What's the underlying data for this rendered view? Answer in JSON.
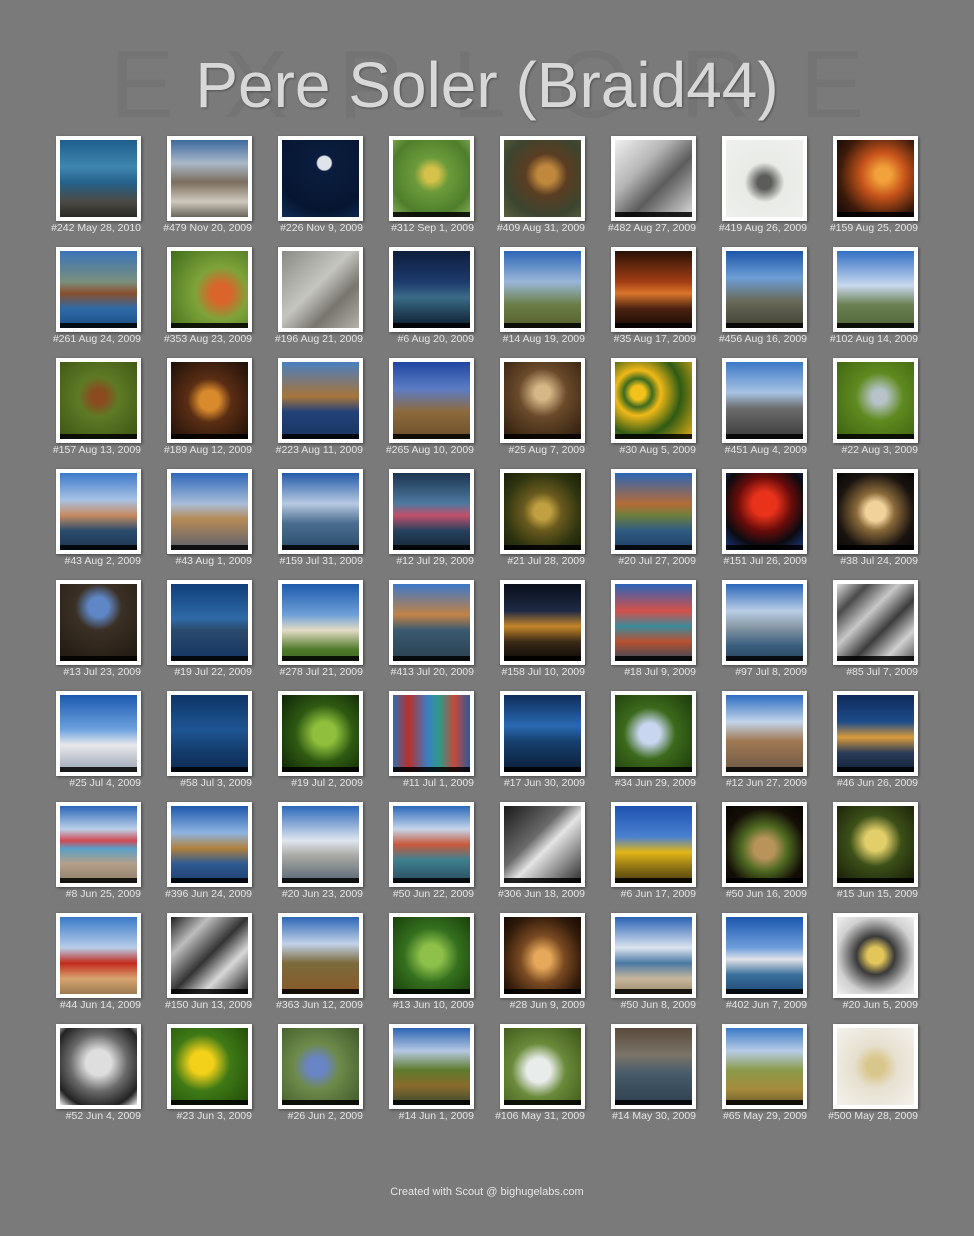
{
  "header": {
    "title": "Pere Soler (Braid44)",
    "watermark": [
      "E",
      "X",
      "P",
      "L",
      "O",
      "R",
      "E"
    ]
  },
  "footer": {
    "text": "Created with Scout @ bighugelabs.com"
  },
  "photos": [
    {
      "caption": "#242 May 28, 2010",
      "bg": "linear-gradient(180deg,#1f5e8c 0%,#3f86b0 35%,#25628a 55%,#4b4a44 80%,#2a2a25 100%)",
      "stripe": false
    },
    {
      "caption": "#479 Nov 20, 2009",
      "bg": "linear-gradient(180deg,#3d6a9c 0%,#a9b8c9 30%,#7b6e5e 55%,#cfc9bd 80%,#6b665c 100%)",
      "stripe": false
    },
    {
      "caption": "#226 Nov 9, 2009",
      "bg": "radial-gradient(circle at 55% 30%,#dfe4ea 0 10%,#0b1d3e 12%,#061631 70%,#0e2d57 100%)",
      "stripe": false
    },
    {
      "caption": "#312 Sep 1, 2009",
      "bg": "radial-gradient(circle at 50% 45%,#d6c24a 0 12%,#6c9b3b 30%,#4f7e2c 70%,#8cb157 100%)",
      "stripe": true
    },
    {
      "caption": "#409 Aug 31, 2009",
      "bg": "radial-gradient(circle at 55% 45%,#c0883d 0 15%,#5a3d22 35%,#3c4530 70%,#59603e 100%)",
      "stripe": false
    },
    {
      "caption": "#482 Aug 27, 2009",
      "bg": "linear-gradient(135deg,#efefef 0%,#b5b5b5 35%,#5c5c5c 60%,#dcdcdc 100%)",
      "stripe": true
    },
    {
      "caption": "#419 Aug 26, 2009",
      "bg": "radial-gradient(circle at 50% 55%,#5c5c5c 0 12%,#e8ebe6 35%,#f0f1ef 100%)",
      "stripe": false
    },
    {
      "caption": "#159 Aug 25, 2009",
      "bg": "radial-gradient(circle at 60% 45%,#f2a23a 0 12%,#c8541b 35%,#3a1a0a 70%,#120604 100%)",
      "stripe": true
    },
    {
      "caption": "#261 Aug 24, 2009",
      "bg": "linear-gradient(180deg,#3b74b8 0%,#7a8f7d 40%,#8a4f2e 55%,#2e6aa8 75%,#1d4d80 100%)",
      "stripe": true
    },
    {
      "caption": "#353 Aug 23, 2009",
      "bg": "radial-gradient(circle at 65% 55%,#d9652a 0 15%,#7fa33a 40%,#3f6d1b 100%)",
      "stripe": true
    },
    {
      "caption": "#196 Aug 21, 2009",
      "bg": "linear-gradient(135deg,#8b8b86 0%,#c6c6c0 45%,#77756e 70%,#b3b1aa 100%)",
      "stripe": false
    },
    {
      "caption": "#6 Aug 20, 2009",
      "bg": "linear-gradient(180deg,#0e1e3c 0%,#1c3a6c 40%,#3a6b86 60%,#0b1a2c 100%)",
      "stripe": true
    },
    {
      "caption": "#14 Aug 19, 2009",
      "bg": "linear-gradient(180deg,#2d67b5 0%,#9ab6d8 40%,#6b7d45 70%,#56612f 100%)",
      "stripe": true
    },
    {
      "caption": "#35 Aug 17, 2009",
      "bg": "linear-gradient(180deg,#2a1208 0%,#a13d14 40%,#d9762a 55%,#4b2210 75%,#1a0a04 100%)",
      "stripe": true
    },
    {
      "caption": "#456 Aug 16, 2009",
      "bg": "linear-gradient(180deg,#1e56a8 0%,#6d9ed6 35%,#6a6a5a 65%,#3f3f33 100%)",
      "stripe": true
    },
    {
      "caption": "#102 Aug 14, 2009",
      "bg": "linear-gradient(180deg,#3270c4 0%,#c9d9ee 45%,#6a8052 70%,#526638 100%)",
      "stripe": true
    },
    {
      "caption": "#157 Aug 13, 2009",
      "bg": "radial-gradient(circle at 50% 45%,#8b4a1f 0 12%,#5e7a25 35%,#3c5414 100%)",
      "stripe": true
    },
    {
      "caption": "#189 Aug 12, 2009",
      "bg": "radial-gradient(circle at 50% 50%,#d98a2c 0 18%,#5b2e14 40%,#1d0f08 100%)",
      "stripe": true
    },
    {
      "caption": "#223 Aug 11, 2009",
      "bg": "linear-gradient(180deg,#4a7fc0 0%,#a7753a 45%,#22417a 65%,#1a3560 100%)",
      "stripe": true
    },
    {
      "caption": "#265 Aug 10, 2009",
      "bg": "linear-gradient(180deg,#2146a0 0%,#5c7cc4 35%,#8d6a3c 65%,#6c4f2b 100%)",
      "stripe": true
    },
    {
      "caption": "#25 Aug 7, 2009",
      "bg": "radial-gradient(circle at 50% 40%,#d6b888 0 12%,#6a4a2a 40%,#2a1a0c 100%)",
      "stripe": true
    },
    {
      "caption": "#30 Aug 5, 2009",
      "bg": "radial-gradient(circle at 30% 40%,#f2c21b 0 10%,#3c6a1e 20%,#f0b918 32%,#2f5a14 60%,#e8b014 100%)",
      "stripe": true
    },
    {
      "caption": "#451 Aug 4, 2009",
      "bg": "linear-gradient(180deg,#3c78c6 0%,#a8c3e3 40%,#6c6c6c 60%,#3b3b3b 100%)",
      "stripe": true
    },
    {
      "caption": "#22 Aug 3, 2009",
      "bg": "radial-gradient(circle at 55% 45%,#b7c3c8 0 12%,#5f8a1f 40%,#3c6010 100%)",
      "stripe": true
    },
    {
      "caption": "#43 Aug 2, 2009",
      "bg": "linear-gradient(180deg,#3d7acb 0%,#a8c2e3 35%,#c58b61 55%,#2a4c6c 75%,#1d3550 100%)",
      "stripe": true
    },
    {
      "caption": "#43 Aug 1, 2009",
      "bg": "linear-gradient(180deg,#2e67b9 0%,#a8bdd8 40%,#b58a55 60%,#5b6170 100%)",
      "stripe": true
    },
    {
      "caption": "#159 Jul 31, 2009",
      "bg": "linear-gradient(180deg,#245aa8 0%,#b7c9e2 40%,#4b6e90 65%,#2b4c6c 100%)",
      "stripe": true
    },
    {
      "caption": "#12 Jul 29, 2009",
      "bg": "linear-gradient(180deg,#1c3450 0%,#4d7aa0 40%,#c2506a 55%,#26425e 75%,#152636 100%)",
      "stripe": true
    },
    {
      "caption": "#21 Jul 28, 2009",
      "bg": "radial-gradient(circle at 50% 50%,#c0a040 0 15%,#6a5a1e 35%,#2f3510 70%,#1a1e08 100%)",
      "stripe": true
    },
    {
      "caption": "#20 Jul 27, 2009",
      "bg": "linear-gradient(180deg,#2d66b6 0%,#b46c38 40%,#6d7f3c 55%,#2f5a82 75%,#1f3f62 100%)",
      "stripe": true
    },
    {
      "caption": "#151 Jul 26, 2009",
      "bg": "radial-gradient(circle at 50% 40%,#e8321a 0 20%,#6a0c0a 45%,#0b0b10 70%,#1b3a8a 100%)",
      "stripe": true
    },
    {
      "caption": "#38 Jul 24, 2009",
      "bg": "radial-gradient(ellipse at 50% 50%,#f0d29a 0 18%,#8a6a3a 35%,#1a1410 70%,#060504 100%)",
      "stripe": true
    },
    {
      "caption": "#13 Jul 23, 2009",
      "bg": "radial-gradient(circle at 50% 30%,#5f87c6 0 15%,#3b3025 35%,#1f1810 100%)",
      "stripe": true
    },
    {
      "caption": "#19 Jul 22, 2009",
      "bg": "linear-gradient(180deg,#0f3e78 0%,#2f6aa8 45%,#2a4a6c 60%,#143463 100%)",
      "stripe": true
    },
    {
      "caption": "#278 Jul 21, 2009",
      "bg": "linear-gradient(180deg,#1e5aab 0%,#6e9fd8 40%,#e4dcc6 60%,#4f7a2a 85%,#3d6620 100%)",
      "stripe": true
    },
    {
      "caption": "#413 Jul 20, 2009",
      "bg": "linear-gradient(180deg,#3c78c9 0%,#c28246 40%,#3a5a70 60%,#2a4050 100%)",
      "stripe": true
    },
    {
      "caption": "#158 Jul 10, 2009",
      "bg": "linear-gradient(180deg,#0a0e1a 0%,#1e2a44 35%,#c6862a 55%,#3a2a18 75%,#0c0a08 100%)",
      "stripe": true
    },
    {
      "caption": "#18 Jul 9, 2009",
      "bg": "linear-gradient(180deg,#2a64b8 0%,#d4514a 35%,#3c8a9a 55%,#b85030 75%,#304a5c 100%)",
      "stripe": true
    },
    {
      "caption": "#97 Jul 8, 2009",
      "bg": "linear-gradient(180deg,#2b66b8 0%,#b9cde6 35%,#8a9aa6 55%,#3a5e7e 80%,#2a4660 100%)",
      "stripe": true
    },
    {
      "caption": "#85 Jul 7, 2009",
      "bg": "linear-gradient(135deg,#dcdcdc 0%,#4a4a4a 20%,#c8c8c8 40%,#3c3c3c 60%,#d0d0d0 80%,#555 100%)",
      "stripe": true
    },
    {
      "caption": "#25 Jul 4, 2009",
      "bg": "linear-gradient(180deg,#1c58b0 0%,#6ea2de 45%,#e8e8ec 65%,#9aa5b4 100%)",
      "stripe": true
    },
    {
      "caption": "#58 Jul 3, 2009",
      "bg": "linear-gradient(180deg,#0d3566 0%,#1e5592 45%,#153f70 70%,#0c2a52 100%)",
      "stripe": true
    },
    {
      "caption": "#19 Jul 2, 2009",
      "bg": "radial-gradient(circle at 55% 50%,#8fbf3c 0 20%,#2f5a12 50%,#0e2406 100%)",
      "stripe": true
    },
    {
      "caption": "#11 Jul 1, 2009",
      "bg": "linear-gradient(90deg,#2f6eae 0%,#b8302c 20%,#3a7ec2 45%,#2e9a8a 60%,#c4483a 80%,#2a5a9c 100%)",
      "stripe": true
    },
    {
      "caption": "#17 Jun 30, 2009",
      "bg": "linear-gradient(180deg,#0e2c5a 0%,#2a6ab2 40%,#17406e 60%,#0b1e38 100%)",
      "stripe": true
    },
    {
      "caption": "#34 Jun 29, 2009",
      "bg": "radial-gradient(circle at 45% 50%,#c8d6f0 0 18%,#3c6a1c 45%,#1e3a0c 100%)",
      "stripe": true
    },
    {
      "caption": "#12 Jun 27, 2009",
      "bg": "linear-gradient(180deg,#2d6dc0 0%,#c3d4ea 35%,#a07852 60%,#6e5a48 100%)",
      "stripe": true
    },
    {
      "caption": "#46 Jun 26, 2009",
      "bg": "linear-gradient(180deg,#0f2a5a 0%,#1d4c8a 35%,#d89a3a 55%,#2a3c58 75%,#102038 100%)",
      "stripe": true
    },
    {
      "caption": "#8 Jun 25, 2009",
      "bg": "linear-gradient(180deg,#2a66b8 0%,#bcd0ea 30%,#cf4a52 45%,#5aa0c8 55%,#b4a08a 75%,#8e7c6a 100%)",
      "stripe": true
    },
    {
      "caption": "#396 Jun 24, 2009",
      "bg": "linear-gradient(180deg,#1d58ab 0%,#8fb4e0 35%,#b0803c 55%,#2f5a92 75%,#1e3e6e 100%)",
      "stripe": true
    },
    {
      "caption": "#20 Jun 23, 2009",
      "bg": "linear-gradient(180deg,#2b68bb 0%,#dfe6ee 45%,#a8a8a4 65%,#556472 100%)",
      "stripe": true
    },
    {
      "caption": "#50 Jun 22, 2009",
      "bg": "linear-gradient(180deg,#2a68bb 0%,#c5d5ea 30%,#c85a3c 50%,#3f8090 70%,#2a4a5c 100%)",
      "stripe": true
    },
    {
      "caption": "#306 Jun 18, 2009",
      "bg": "linear-gradient(135deg,#1a1a1a 0%,#6a6a6a 40%,#e4e4e4 55%,#2a2a2a 100%)",
      "stripe": true
    },
    {
      "caption": "#6 Jun 17, 2009",
      "bg": "linear-gradient(180deg,#1e52b0 0%,#4a80d0 40%,#e2b618 60%,#7a6412 85%,#4a3c0c 100%)",
      "stripe": true
    },
    {
      "caption": "#50 Jun 16, 2009",
      "bg": "radial-gradient(circle at 50% 55%,#b8945a 0 18%,#4f6a22 40%,#140e06 70%,#050302 100%)",
      "stripe": true
    },
    {
      "caption": "#15 Jun 15, 2009",
      "bg": "radial-gradient(circle at 50% 45%,#e2cf6a 0 18%,#3c5018 45%,#171a08 100%)",
      "stripe": true
    },
    {
      "caption": "#44 Jun 14, 2009",
      "bg": "linear-gradient(180deg,#3a7ac8 0%,#b8cde8 40%,#c22a1c 60%,#d8a470 80%,#9c7a52 100%)",
      "stripe": false
    },
    {
      "caption": "#150 Jun 13, 2009",
      "bg": "linear-gradient(135deg,#202020 0%,#bdbdbd 25%,#333 50%,#d8d8d8 70%,#151515 100%)",
      "stripe": true
    },
    {
      "caption": "#363 Jun 12, 2009",
      "bg": "linear-gradient(180deg,#2c66b6 0%,#c2d2e8 35%,#7a6a3c 60%,#8a5a28 100%)",
      "stripe": true
    },
    {
      "caption": "#13 Jun 10, 2009",
      "bg": "radial-gradient(circle at 50% 50%,#8ec04a 0 20%,#35701e 50%,#18400c 100%)",
      "stripe": true
    },
    {
      "caption": "#28 Jun 9, 2009",
      "bg": "radial-gradient(ellipse at 50% 55%,#e6a85a 0 15%,#7a4a22 40%,#301a0a 75%,#150a04 100%)",
      "stripe": true
    },
    {
      "caption": "#50 Jun 8, 2009",
      "bg": "linear-gradient(180deg,#2a62b4 0%,#dbe4ef 40%,#4a78a4 60%,#c6b69a 80%,#9e8a6e 100%)",
      "stripe": true
    },
    {
      "caption": "#402 Jun 7, 2009",
      "bg": "linear-gradient(180deg,#1b57ad 0%,#6f9edc 40%,#e0e2e6 55%,#3a6f9c 75%,#204a74 100%)",
      "stripe": true
    },
    {
      "caption": "#20 Jun 5, 2009",
      "bg": "radial-gradient(circle at 50% 50%,#e2c65a 0 15%,#3a3a3a 35%,#d0d0d0 70%,#f0f0f0 100%)",
      "stripe": false
    },
    {
      "caption": "#52 Jun 4, 2009",
      "bg": "radial-gradient(circle at 50% 45%,#dedede 0 22%,#6a6a6a 50%,#222 80%,#f4f4f4 100%)",
      "stripe": false
    },
    {
      "caption": "#23 Jun 3, 2009",
      "bg": "radial-gradient(circle at 40% 45%,#f3d11a 0 18%,#3f7a16 45%,#1f4a08 100%)",
      "stripe": true
    },
    {
      "caption": "#26 Jun 2, 2009",
      "bg": "radial-gradient(circle at 45% 50%,#6a84c8 0 15%,#6e8a4a 40%,#405a2a 100%)",
      "stripe": true
    },
    {
      "caption": "#14 Jun 1, 2009",
      "bg": "linear-gradient(180deg,#2a64b4 0%,#b6c8e2 30%,#5e7a2c 55%,#8a6a2c 75%,#3a4a30 100%)",
      "stripe": true
    },
    {
      "caption": "#106 May 31, 2009",
      "bg": "radial-gradient(circle at 45% 55%,#e8ecea 0 20%,#6b8a3a 45%,#3a5418 100%)",
      "stripe": true
    },
    {
      "caption": "#14 May 30, 2009",
      "bg": "linear-gradient(180deg,#5a4a3c 0%,#7a7468 35%,#465a6a 60%,#2f4050 100%)",
      "stripe": true
    },
    {
      "caption": "#65 May 29, 2009",
      "bg": "linear-gradient(180deg,#3a7ac6 0%,#b8cce6 30%,#8a9a4a 55%,#a68a3c 80%,#6a5a2a 100%)",
      "stripe": true
    },
    {
      "caption": "#500 May 28, 2009",
      "bg": "radial-gradient(circle at 50% 50%,#d9c68a 0 15%,#e6e0d0 40%,#f4f2ec 100%)",
      "stripe": false
    }
  ]
}
